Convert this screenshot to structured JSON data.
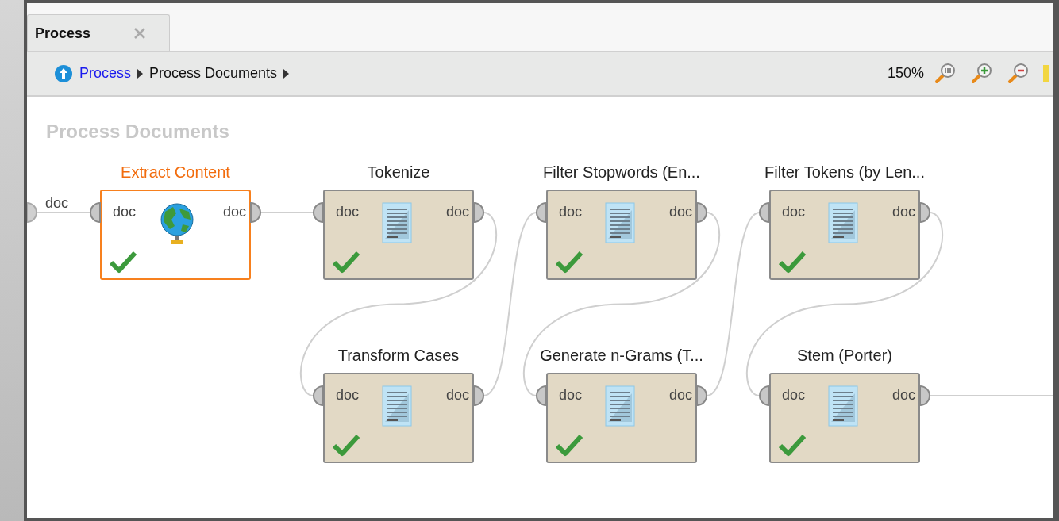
{
  "tab": {
    "label": "Process"
  },
  "breadcrumb": [
    {
      "label": "Process",
      "kind": "link"
    },
    {
      "label": "Process Documents",
      "kind": "current"
    }
  ],
  "zoom": {
    "label": "150%"
  },
  "canvas": {
    "title": "Process Documents",
    "input_port": "doc",
    "operators": [
      {
        "title": "Extract Content",
        "kind": "web",
        "selected": true,
        "executed": true,
        "input": "doc",
        "output": "doc"
      },
      {
        "title": "Tokenize",
        "kind": "text",
        "selected": false,
        "executed": true,
        "input": "doc",
        "output": "doc"
      },
      {
        "title": "Filter Stopwords (En...",
        "kind": "text",
        "selected": false,
        "executed": true,
        "input": "doc",
        "output": "doc"
      },
      {
        "title": "Filter Tokens (by Len...",
        "kind": "text",
        "selected": false,
        "executed": true,
        "input": "doc",
        "output": "doc"
      },
      {
        "title": "Transform Cases",
        "kind": "text",
        "selected": false,
        "executed": true,
        "input": "doc",
        "output": "doc"
      },
      {
        "title": "Generate n-Grams (T...",
        "kind": "text",
        "selected": false,
        "executed": true,
        "input": "doc",
        "output": "doc"
      },
      {
        "title": "Stem (Porter)",
        "kind": "text",
        "selected": false,
        "executed": true,
        "input": "doc",
        "output": "doc"
      }
    ]
  }
}
